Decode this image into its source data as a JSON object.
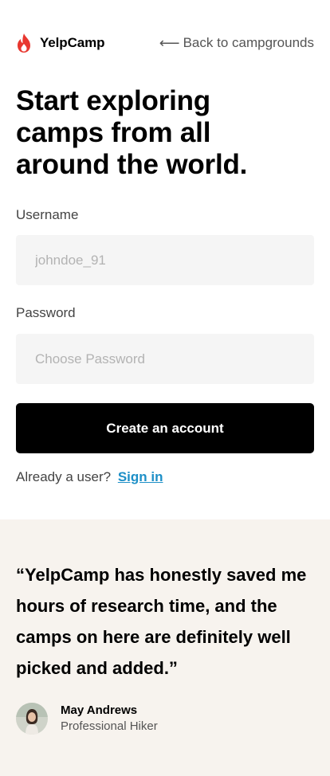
{
  "header": {
    "brand_name": "YelpCamp",
    "logo_icon": "flame-icon",
    "back_link": "Back to campgrounds",
    "back_icon": "arrow-left-icon"
  },
  "headline": "Start exploring camps from all around the world.",
  "form": {
    "username_label": "Username",
    "username_placeholder": "johndoe_91",
    "password_label": "Password",
    "password_placeholder": "Choose Password",
    "submit_label": "Create an account",
    "signin_prompt": "Already a user?",
    "signin_link": "Sign in"
  },
  "testimonial": {
    "quote": "“YelpCamp has honestly saved me hours of research time, and the camps on here are definitely well picked and added.”",
    "author_name": "May Andrews",
    "author_role": "Professional Hiker"
  },
  "colors": {
    "brand_red": "#e8372f",
    "link_blue": "#1d8fc7",
    "button_black": "#000000",
    "testimonial_bg": "#f7f3ee",
    "input_bg": "#f5f5f5"
  }
}
